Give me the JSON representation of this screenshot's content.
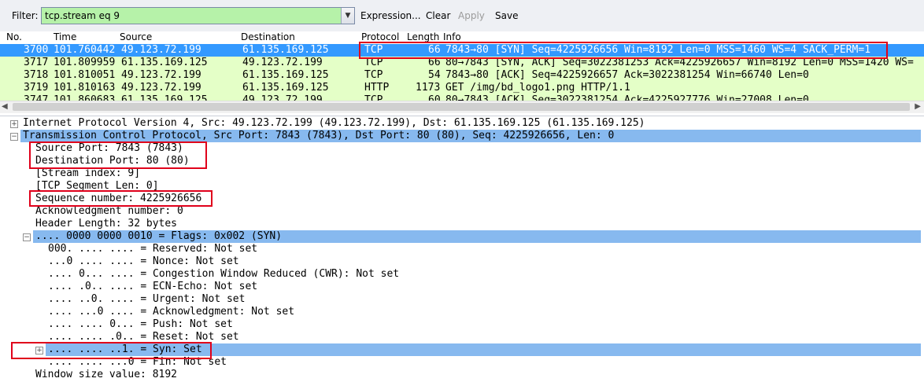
{
  "toolbar": {
    "filter_label": "Filter:",
    "filter_value": "tcp.stream eq 9",
    "expression_label": "Expression...",
    "clear_label": "Clear",
    "apply_label": "Apply",
    "save_label": "Save"
  },
  "packet_list": {
    "columns": [
      "No.",
      "Time",
      "Source",
      "Destination",
      "Protocol",
      "Length",
      "Info"
    ],
    "rows": [
      {
        "no": "3700",
        "time": "101.760442",
        "source": "49.123.72.199",
        "destination": "61.135.169.125",
        "protocol": "TCP",
        "length": "66",
        "info": "7843→80 [SYN] Seq=4225926656 Win=8192 Len=0 MSS=1460 WS=4 SACK_PERM=1"
      },
      {
        "no": "3717",
        "time": "101.809959",
        "source": "61.135.169.125",
        "destination": "49.123.72.199",
        "protocol": "TCP",
        "length": "66",
        "info": "80→7843 [SYN, ACK] Seq=3022381253 Ack=4225926657 Win=8192 Len=0 MSS=1420 WS="
      },
      {
        "no": "3718",
        "time": "101.810051",
        "source": "49.123.72.199",
        "destination": "61.135.169.125",
        "protocol": "TCP",
        "length": "54",
        "info": "7843→80 [ACK] Seq=4225926657 Ack=3022381254 Win=66740 Len=0"
      },
      {
        "no": "3719",
        "time": "101.810163",
        "source": "49.123.72.199",
        "destination": "61.135.169.125",
        "protocol": "HTTP",
        "length": "1173",
        "info": "GET /img/bd_logo1.png HTTP/1.1"
      },
      {
        "no": "3747",
        "time": "101.860683",
        "source": "61.135.169.125",
        "destination": "49.123.72.199",
        "protocol": "TCP",
        "length": "60",
        "info": "80→7843 [ACK] Seq=3022381254 Ack=4225927776 Win=27008 Len=0"
      }
    ]
  },
  "tree": {
    "ip_line": "Internet Protocol Version 4, Src: 49.123.72.199 (49.123.72.199), Dst: 61.135.169.125 (61.135.169.125)",
    "tcp_line": "Transmission Control Protocol, Src Port: 7843 (7843), Dst Port: 80 (80), Seq: 4225926656, Len: 0",
    "source_port": "Source Port: 7843 (7843)",
    "destination_port": "Destination Port: 80 (80)",
    "stream_index": "[Stream index: 9]",
    "segment_len": "[TCP Segment Len: 0]",
    "sequence_number": "Sequence number: 4225926656",
    "ack_number": "Acknowledgment number: 0",
    "header_length": "Header Length: 32 bytes",
    "flags_line": ".... 0000 0000 0010 = Flags: 0x002 (SYN)",
    "flags": [
      "000. .... .... = Reserved: Not set",
      "...0 .... .... = Nonce: Not set",
      ".... 0... .... = Congestion Window Reduced (CWR): Not set",
      ".... .0.. .... = ECN-Echo: Not set",
      ".... ..0. .... = Urgent: Not set",
      ".... ...0 .... = Acknowledgment: Not set",
      ".... .... 0... = Push: Not set",
      ".... .... .0.. = Reset: Not set",
      ".... .... ..1. = Syn: Set",
      ".... .... ...0 = Fin: Not set"
    ],
    "window_size": "Window size value: 8192"
  },
  "colors": {
    "filter_valid": "#b6f2a9",
    "selected_row": "#3399ff",
    "tcp_row": "#e4ffc7",
    "tree_highlight": "#87b9ef",
    "annotation_red": "#e0001b"
  }
}
